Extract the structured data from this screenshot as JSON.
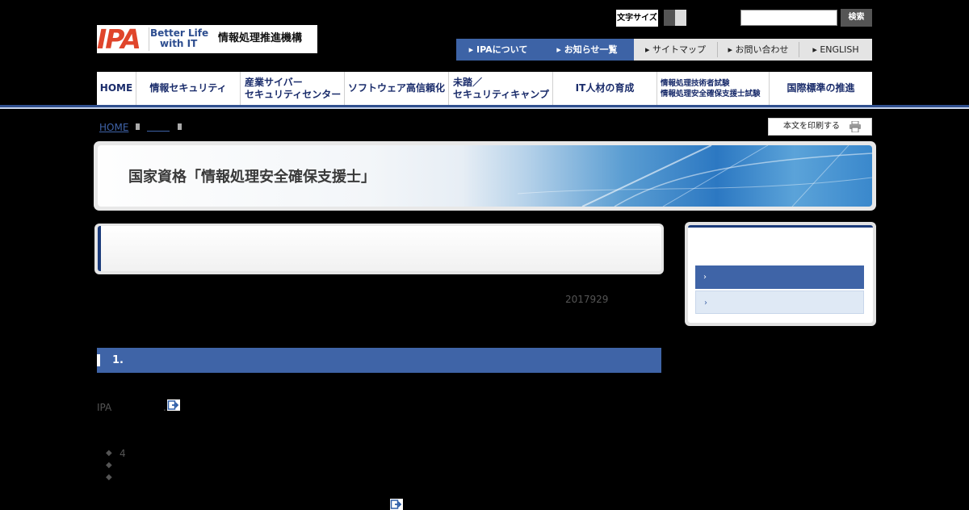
{
  "header": {
    "logo_mark": "IPA",
    "logo_tagline_1": "Better Life",
    "logo_tagline_2": "with IT",
    "org_name": "情報処理推進機構",
    "font_size_label": "文字サイズ",
    "search_placeholder": "",
    "search_button": "検索"
  },
  "utility_nav": [
    {
      "label": "▸ IPAについて"
    },
    {
      "label": "▸ お知らせ一覧"
    },
    {
      "label": "▸ サイトマップ"
    },
    {
      "label": "▸ お問い合わせ"
    },
    {
      "label": "▸ ENGLISH"
    }
  ],
  "global_nav": {
    "home": "HOME",
    "security": "情報セキュリティ",
    "cyber_1": "産業サイバー",
    "cyber_2": "セキュリティセンター",
    "software": "ソフトウェア高信頼化",
    "mito_1": "未踏／",
    "mito_2": "セキュリティキャンプ",
    "it_jinzai": "IT人材の育成",
    "exam_1": "情報処理技術者試験",
    "exam_2": "情報処理安全確保支援士試験",
    "standards": "国際標準の推進"
  },
  "breadcrumb": {
    "home": "HOME"
  },
  "print_button": "本文を印刷する",
  "banner_title": "国家資格「情報処理安全確保支援士」",
  "date": "2017929",
  "section_heading": "1.",
  "body_text": "IPA",
  "body_punct": ".",
  "bullets": [
    "4",
    "",
    ""
  ],
  "side_menu": [
    {
      "label": "›"
    },
    {
      "label": "›"
    }
  ],
  "colors": {
    "nav_blue": "#3d63a6",
    "dark_navy": "#1b3b7a",
    "logo_red": "#e0452b"
  }
}
